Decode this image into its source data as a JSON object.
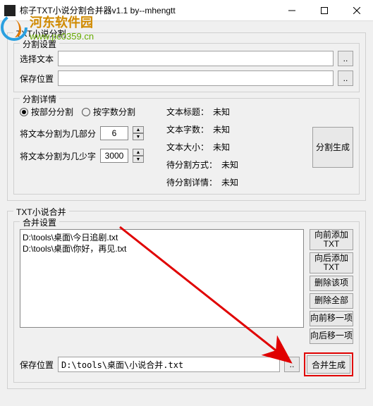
{
  "title": "棕子TXT小说分割合并器v1.1      by--mhengtt",
  "watermark": {
    "title": "河东软件园",
    "url": "www.pc0359.cn"
  },
  "split_section": {
    "legend": "TXT小说分割",
    "settings_legend": "分割设置",
    "select_text_label": "选择文本",
    "select_text_value": "",
    "browse_btn": "..",
    "save_loc_label": "保存位置",
    "save_loc_value": "",
    "details_legend": "分割详情",
    "radio_by_part": "按部分分割",
    "radio_by_chars": "按字数分割",
    "parts_label": "将文本分割为几部分",
    "parts_value": "6",
    "chars_label": "将文本分割为几少字",
    "chars_value": "3000",
    "info_title_label": "文本标题：",
    "info_title_val": "未知",
    "info_chars_label": "文本字数：",
    "info_chars_val": "未知",
    "info_size_label": "文本大小：",
    "info_size_val": "未知",
    "info_method_label": "待分割方式：",
    "info_method_val": "未知",
    "info_detail_label": "待分割详情：",
    "info_detail_val": "未知",
    "split_btn": "分割生成"
  },
  "merge_section": {
    "legend": "TXT小说合并",
    "settings_legend": "合并设置",
    "list_items": [
      "D:\\tools\\桌面\\今日追剧.txt",
      "D:\\tools\\桌面\\你好，再见.txt"
    ],
    "btn_add_front": "向前添加TXT",
    "btn_add_back": "向后添加TXT",
    "btn_del_item": "删除该项",
    "btn_del_all": "删除全部",
    "btn_move_up": "向前移一项",
    "btn_move_down": "向后移一项",
    "save_label": "保存位置",
    "save_value": "D:\\tools\\桌面\\小说合并.txt",
    "browse_btn": "..",
    "merge_btn": "合并生成"
  }
}
